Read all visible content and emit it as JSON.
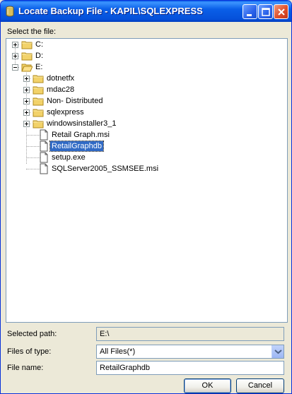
{
  "window": {
    "title": "Locate Backup File - KAPIL\\SQLEXPRESS"
  },
  "labels": {
    "select_file": "Select the file:",
    "selected_path": "Selected path:",
    "files_of_type": "Files of type:",
    "file_name": "File name:"
  },
  "tree": {
    "drives": [
      "C:",
      "D:",
      "E:"
    ],
    "folders": [
      "dotnetfx",
      "mdac28",
      "Non- Distributed",
      "sqlexpress",
      "windowsinstaller3_1"
    ],
    "files": [
      "Retail Graph.msi",
      "RetailGraphdb",
      "setup.exe",
      "SQLServer2005_SSMSEE.msi"
    ],
    "selected": "RetailGraphdb"
  },
  "fields": {
    "selected_path": "E:\\",
    "files_of_type": "All Files(*)",
    "file_name": "RetailGraphdb"
  },
  "buttons": {
    "ok": "OK",
    "cancel": "Cancel"
  },
  "colors": {
    "titlebar": "#0A5FE8",
    "selection": "#316AC5",
    "folder": "#F2D26A"
  }
}
